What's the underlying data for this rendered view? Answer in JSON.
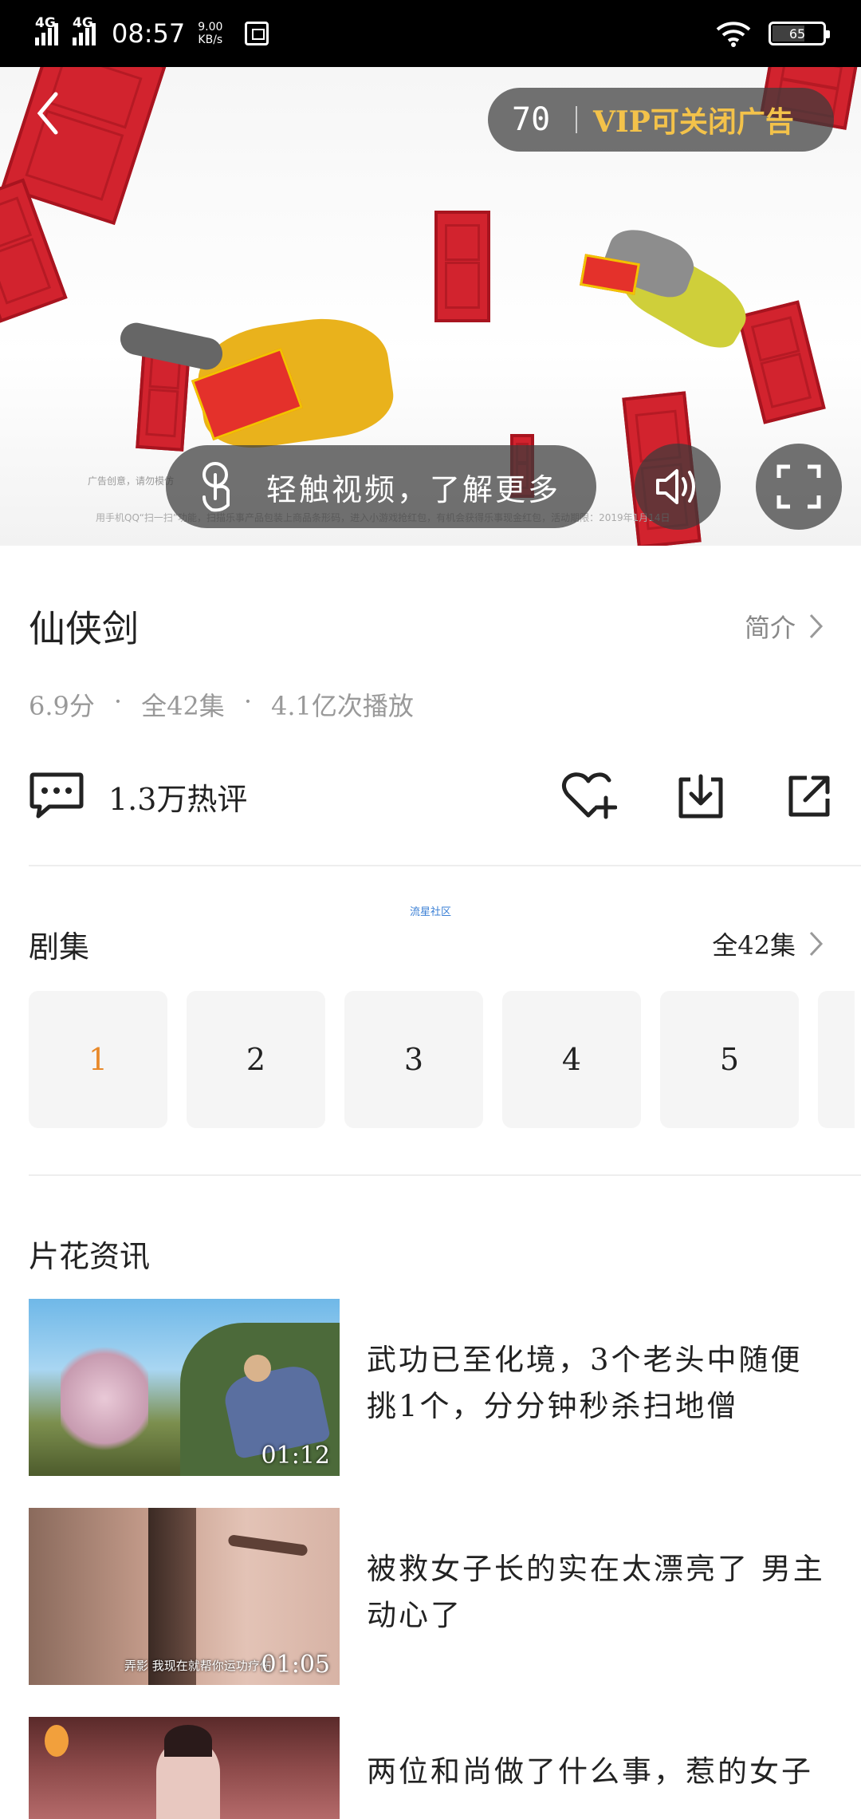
{
  "status_bar": {
    "sim1": "4G",
    "sim2": "4G",
    "time": "08:57",
    "speed_value": "9.00",
    "speed_unit": "KB/s",
    "battery": "65"
  },
  "ad": {
    "countdown": "70",
    "vip_text": "VIP可关闭广告",
    "touch_text": "轻触视频，了解更多",
    "fine_print_1": "广告创意，请勿模仿",
    "fine_print_2": "用手机QQ“扫一扫”功能，扫描乐事产品包装上商品条形码，进入小游戏抢红包，有机会获得乐事现金红包，活动期限：2019年1月14日"
  },
  "show": {
    "title": "仙侠剑",
    "intro_label": "简介",
    "rating": "6.9分",
    "episodes_count": "全42集",
    "plays": "4.1亿次播放",
    "comments": "1.3万热评"
  },
  "credit": "流星社区",
  "episodes": {
    "section_title": "剧集",
    "all_label": "全42集",
    "items": [
      "1",
      "2",
      "3",
      "4",
      "5"
    ]
  },
  "news": {
    "section_title": "片花资讯",
    "items": [
      {
        "title": "武功已至化境，3个老头中随便挑1个，分分钟秒杀扫地僧",
        "duration": "01:12",
        "subtitle": ""
      },
      {
        "title": "被救女子长的实在太漂亮了 男主动心了",
        "duration": "01:05",
        "subtitle": "弄影 我现在就帮你运功疗伤"
      },
      {
        "title": "两位和尚做了什么事，惹的女子",
        "duration": "",
        "subtitle": ""
      }
    ]
  },
  "colors": {
    "accent_orange": "#e8892a",
    "vip_gold": "#f3c24a",
    "door_red": "#d2232e"
  }
}
